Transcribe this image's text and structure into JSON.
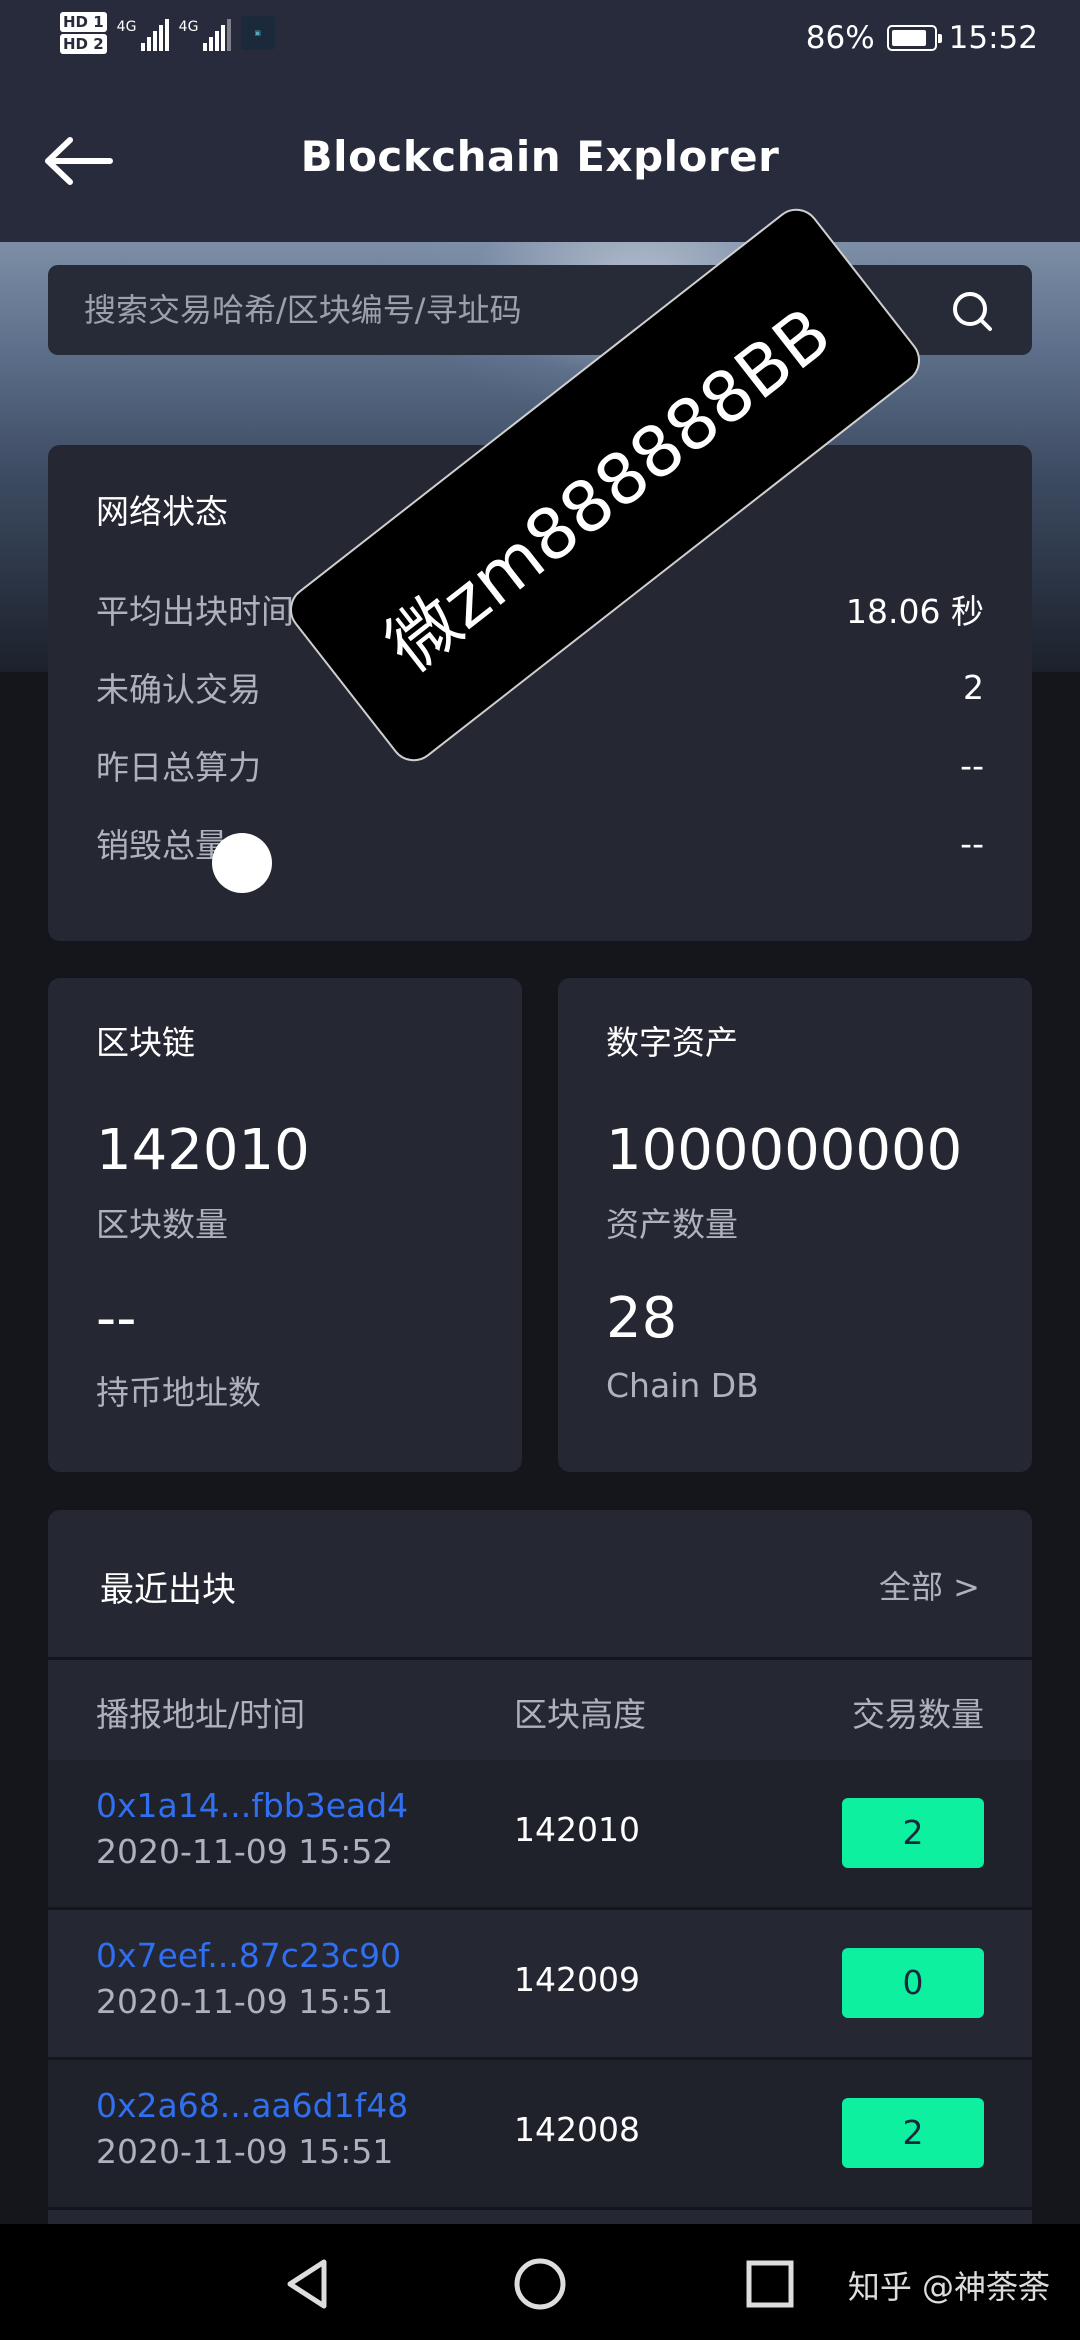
{
  "status_bar": {
    "hd1": "HD 1",
    "hd2": "HD 2",
    "signal1_label": "4G",
    "signal2_label": "4G",
    "battery_percent": "86%",
    "battery_level": 0.86,
    "time": "15:52"
  },
  "header": {
    "title": "Blockchain Explorer"
  },
  "search": {
    "placeholder": "搜索交易哈希/区块编号/寻址码"
  },
  "network_status": {
    "title": "网络状态",
    "rows": [
      {
        "label": "平均出块时间",
        "value": "18.06 秒"
      },
      {
        "label": "未确认交易",
        "value": "2"
      },
      {
        "label": "昨日总算力",
        "value": "--"
      },
      {
        "label": "销毁总量",
        "value": "--"
      }
    ]
  },
  "blockchain": {
    "title": "区块链",
    "block_count": "142010",
    "block_count_label": "区块数量",
    "holder_count": "--",
    "holder_count_label": "持币地址数"
  },
  "digital_assets": {
    "title": "数字资产",
    "asset_count": "1000000000",
    "asset_count_label": "资产数量",
    "chain_db": "28",
    "chain_db_label": "Chain DB"
  },
  "recent_blocks": {
    "title": "最近出块",
    "all_link": "全部 >",
    "columns": [
      "播报地址/时间",
      "区块高度",
      "交易数量"
    ],
    "rows": [
      {
        "address": "0x1a14...fbb3ead4",
        "time": "2020-11-09 15:52",
        "height": "142010",
        "tx_count": "2"
      },
      {
        "address": "0x7eef...87c23c90",
        "time": "2020-11-09 15:51",
        "height": "142009",
        "tx_count": "0"
      },
      {
        "address": "0x2a68...aa6d1f48",
        "time": "2020-11-09 15:51",
        "height": "142008",
        "tx_count": "2"
      }
    ]
  },
  "watermark": {
    "text": "微zm888888BB"
  },
  "nav_bar": {
    "credit": "知乎 @神荼荼"
  },
  "colors": {
    "background": "#15161c",
    "header": "#272b3c",
    "card": "#252733",
    "link_blue": "#2f6ff0",
    "badge_green": "#0cf0a0"
  }
}
